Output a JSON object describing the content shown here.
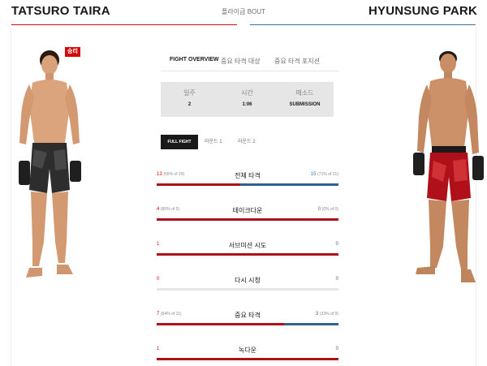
{
  "header": {
    "red_name": "TATSURO TAIRA",
    "blue_name": "HYUNSUNG PARK",
    "weight_class": "플라이급 BOUT"
  },
  "red_fighter": {
    "result_badge": "승리",
    "image": "fighter-red-corner-photo"
  },
  "blue_fighter": {
    "image": "fighter-blue-corner-photo"
  },
  "tabs": [
    {
      "label": "FIGHT OVERVIEW",
      "active": true
    },
    {
      "label": "중요 타격 대상",
      "active": false
    },
    {
      "label": "중요 타격 포지션",
      "active": false
    }
  ],
  "fight_info": [
    {
      "label": "일주",
      "value": "2"
    },
    {
      "label": "시간",
      "value": "1:06"
    },
    {
      "label": "메소드",
      "value": "SUBMISSION"
    }
  ],
  "round_tabs": [
    {
      "label": "FULL FIGHT",
      "active": true
    },
    {
      "label": "라운드 1",
      "active": false
    },
    {
      "label": "라운드 2",
      "active": false
    }
  ],
  "stats": [
    {
      "title": "전체 타격",
      "red_value": "13",
      "red_detail": "(65% of 20)",
      "blue_value": "15",
      "blue_detail": "(71% of 21)",
      "red_share": 0.46,
      "blue_share": 0.54
    },
    {
      "title": "테이크다운",
      "red_value": "4",
      "red_detail": "(80% of 5)",
      "blue_value": "0",
      "blue_detail": "(0% of 0)",
      "red_share": 1.0,
      "blue_share": 0.0
    },
    {
      "title": "서브미션 시도",
      "red_value": "1",
      "red_detail": "",
      "blue_value": "0",
      "blue_detail": "",
      "red_share": 1.0,
      "blue_share": 0.0
    },
    {
      "title": "다시 시청",
      "red_value": "0",
      "red_detail": "",
      "blue_value": "0",
      "blue_detail": "",
      "red_share": 0.0,
      "blue_share": 0.0
    },
    {
      "title": "중요 타격",
      "red_value": "7",
      "red_detail": "(64% of 11)",
      "blue_value": "3",
      "blue_detail": "(33% of 9)",
      "red_share": 0.7,
      "blue_share": 0.3
    },
    {
      "title": "녹다운",
      "red_value": "1",
      "red_detail": "",
      "blue_value": "0",
      "blue_detail": "",
      "red_share": 1.0,
      "blue_share": 0.0
    }
  ],
  "colors": {
    "red_corner": "#d20a0a",
    "blue_corner": "#3d6fa3",
    "track": "#e5e5e5"
  }
}
